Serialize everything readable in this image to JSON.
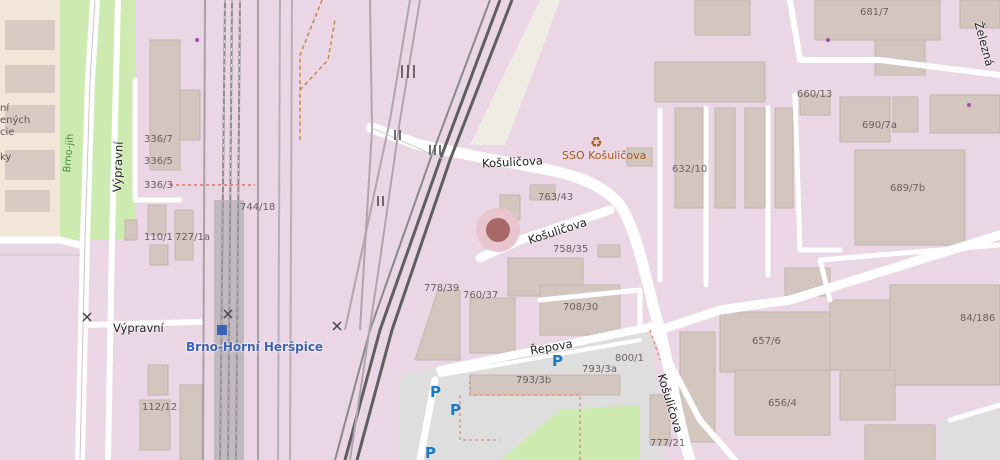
{
  "map": {
    "streets": {
      "kosulicova_top": "Košuličova",
      "kosulicova_mid": "Košuličova",
      "kosulicova_vertical": "Košuličova",
      "vypravni_vertical": "Výpravní",
      "vypravni_horizontal": "Výpravní",
      "repova": "Řepova",
      "zelezna": "Železná",
      "brno_jih": "Brno-jih"
    },
    "house_numbers": [
      "681/7",
      "660/13",
      "690/7a",
      "632/10",
      "689/7b",
      "336/7",
      "336/5",
      "336/3",
      "744/18",
      "110/1",
      "727/1a",
      "763/43",
      "758/35",
      "778/39",
      "760/37",
      "708/30",
      "657/6",
      "84/186",
      "800/1",
      "793/3b",
      "793/3a",
      "656/4",
      "777/21",
      "112/12"
    ],
    "poi": {
      "recycling_label": "SSO Košuličova",
      "station_name": "Brno-Horní Heršpice"
    },
    "left_edge_text": [
      "ní",
      "ených",
      "cie",
      "ky"
    ],
    "parking_symbol": "P",
    "colors": {
      "background": "#ead6e4",
      "building": "#d3c6bf",
      "road": "#ffffff",
      "rail": "#808080",
      "parking_area": "#dedede",
      "grass": "#cdebb0",
      "poi_circle": "#a86868",
      "brownfield": "#f0ece4",
      "station_blue": "#3d61b5"
    }
  }
}
